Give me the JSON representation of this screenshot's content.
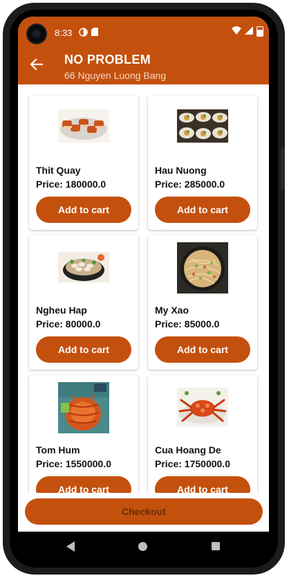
{
  "status_bar": {
    "time": "8:33"
  },
  "toolbar": {
    "title": "NO PROBLEM",
    "subtitle": "66 Nguyen Luong Bang"
  },
  "products": [
    {
      "name": "Thit Quay",
      "price": "Price: 180000.0",
      "button": "Add to cart"
    },
    {
      "name": "Hau Nuong",
      "price": "Price: 285000.0",
      "button": "Add to cart"
    },
    {
      "name": "Ngheu Hap",
      "price": "Price: 80000.0",
      "button": "Add to cart"
    },
    {
      "name": "My Xao",
      "price": "Price: 85000.0",
      "button": "Add to cart"
    },
    {
      "name": "Tom Hum",
      "price": "Price: 1550000.0",
      "button": "Add to cart"
    },
    {
      "name": "Cua Hoang De",
      "price": "Price: 1750000.0",
      "button": "Add to cart"
    }
  ],
  "checkout_label": "Checkout",
  "colors": {
    "accent": "#c4500e",
    "checkout_text": "#6b2a05"
  }
}
